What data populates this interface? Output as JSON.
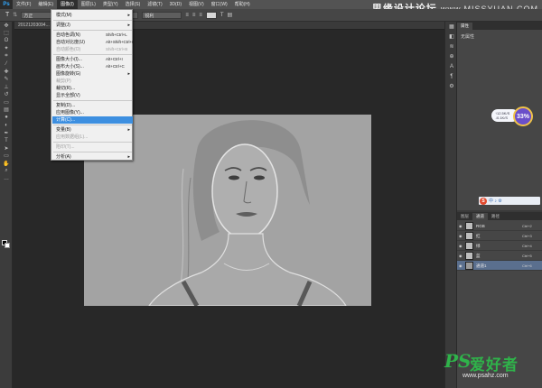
{
  "app": {
    "logo": "Ps"
  },
  "menubar": {
    "items": [
      {
        "label": "文件(F)"
      },
      {
        "label": "编辑(E)"
      },
      {
        "label": "图像(I)",
        "active": true
      },
      {
        "label": "图层(L)"
      },
      {
        "label": "类型(Y)"
      },
      {
        "label": "选择(S)"
      },
      {
        "label": "滤镜(T)"
      },
      {
        "label": "3D(D)"
      },
      {
        "label": "视图(V)"
      },
      {
        "label": "窗口(W)"
      },
      {
        "label": "帮助(H)"
      }
    ]
  },
  "watermark_top": {
    "text": "思缘设计论坛",
    "site": "www.MISSYUAN.COM"
  },
  "options_bar": {
    "preset": "方正",
    "mode": "锐利"
  },
  "document": {
    "tab_label": "20121203094..."
  },
  "image_menu": {
    "items": [
      {
        "label": "模式(M)",
        "shortcut": "",
        "submenu": true,
        "disabled": false
      },
      {
        "sep": true
      },
      {
        "label": "调整(J)",
        "shortcut": "",
        "submenu": true,
        "disabled": false
      },
      {
        "sep": true
      },
      {
        "label": "自动色调(N)",
        "shortcut": "Shift+Ctrl+L",
        "disabled": false
      },
      {
        "label": "自动对比度(U)",
        "shortcut": "Alt+Shift+Ctrl+L",
        "disabled": false
      },
      {
        "label": "自动颜色(O)",
        "shortcut": "Shift+Ctrl+B",
        "disabled": true
      },
      {
        "sep": true
      },
      {
        "label": "图像大小(I)...",
        "shortcut": "Alt+Ctrl+I",
        "disabled": false
      },
      {
        "label": "画布大小(S)...",
        "shortcut": "Alt+Ctrl+C",
        "disabled": false
      },
      {
        "label": "图像旋转(G)",
        "shortcut": "",
        "submenu": true,
        "disabled": false
      },
      {
        "label": "裁剪(P)",
        "shortcut": "",
        "disabled": true
      },
      {
        "label": "裁切(R)...",
        "shortcut": "",
        "disabled": false
      },
      {
        "label": "显示全部(V)",
        "shortcut": "",
        "disabled": false
      },
      {
        "sep": true
      },
      {
        "label": "复制(D)...",
        "shortcut": "",
        "disabled": false
      },
      {
        "label": "应用图像(Y)...",
        "shortcut": "",
        "disabled": false
      },
      {
        "label": "计算(C)...",
        "shortcut": "",
        "disabled": false,
        "highlighted": true
      },
      {
        "sep": true
      },
      {
        "label": "变量(B)",
        "shortcut": "",
        "submenu": true,
        "disabled": false
      },
      {
        "label": "应用数据组(L)...",
        "shortcut": "",
        "disabled": true
      },
      {
        "sep": true
      },
      {
        "label": "陷印(T)...",
        "shortcut": "",
        "disabled": true
      },
      {
        "sep": true
      },
      {
        "label": "分析(A)",
        "shortcut": "",
        "submenu": true,
        "disabled": false
      }
    ]
  },
  "properties_panel": {
    "tab": "属性",
    "label": "无属性"
  },
  "gadget": {
    "line1": "↑12.5K/S",
    "line2": "↓0.1K/S",
    "percent": "33%"
  },
  "ime": {
    "logo": "S",
    "icons": "中 ♪ ⚙"
  },
  "channels_panel": {
    "tabs": [
      {
        "label": "图层"
      },
      {
        "label": "通道",
        "active": true
      },
      {
        "label": "路径"
      }
    ],
    "rows": [
      {
        "name": "RGB",
        "shortcut": "Ctrl+2",
        "selected": false
      },
      {
        "name": "红",
        "shortcut": "Ctrl+3",
        "selected": false
      },
      {
        "name": "绿",
        "shortcut": "Ctrl+4",
        "selected": false
      },
      {
        "name": "蓝",
        "shortcut": "Ctrl+5",
        "selected": false
      },
      {
        "name": "通道1",
        "shortcut": "Ctrl+6",
        "selected": true
      }
    ]
  },
  "watermark_bottom": {
    "ps": "PS",
    "cn": "爱好者",
    "url": "www.psahz.com"
  },
  "colors": {
    "canvas": "#a2a2a2",
    "menu_highlight": "#3d8fe0",
    "ui_dark": "#282828",
    "logo_green": "#2fb34a"
  }
}
